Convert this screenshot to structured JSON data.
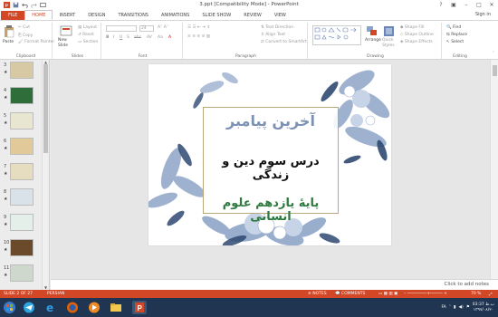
{
  "window": {
    "title": "3.ppt [Compatibility Mode] - PowerPoint"
  },
  "tabs": [
    {
      "label": "FILE"
    },
    {
      "label": "HOME"
    },
    {
      "label": "INSERT"
    },
    {
      "label": "DESIGN"
    },
    {
      "label": "TRANSITIONS"
    },
    {
      "label": "ANIMATIONS"
    },
    {
      "label": "SLIDE SHOW"
    },
    {
      "label": "REVIEW"
    },
    {
      "label": "VIEW"
    }
  ],
  "signin": "Sign in",
  "ribbon": {
    "clipboard": {
      "label": "Clipboard",
      "paste": "Paste",
      "cut": "Cut",
      "copy": "Copy",
      "format_painter": "Format Painter"
    },
    "slides": {
      "label": "Slides",
      "new_slide": "New Slide",
      "layout": "Layout",
      "reset": "Reset",
      "section": "Section"
    },
    "font": {
      "label": "Font",
      "size": "24"
    },
    "paragraph": {
      "label": "Paragraph",
      "text_direction": "Text Direction",
      "align_text": "Align Text",
      "smartart": "Convert to SmartArt"
    },
    "drawing": {
      "label": "Drawing",
      "arrange": "Arrange",
      "quick_styles": "Quick Styles",
      "fill": "Shape Fill",
      "outline": "Shape Outline",
      "effects": "Shape Effects"
    },
    "editing": {
      "label": "Editing",
      "find": "Find",
      "replace": "Replace",
      "select": "Select"
    }
  },
  "thumbnails": [
    {
      "num": "3",
      "star": "★",
      "color": "#d8c9a5"
    },
    {
      "num": "4",
      "star": "★",
      "color": "#2f6d3a"
    },
    {
      "num": "5",
      "star": "★",
      "color": "#e8e6d0"
    },
    {
      "num": "6",
      "star": "★",
      "color": "#e1c99a"
    },
    {
      "num": "7",
      "star": "★",
      "color": "#e6dcc0"
    },
    {
      "num": "8",
      "star": "★",
      "color": "#d9e2e8"
    },
    {
      "num": "9",
      "star": "★",
      "color": "#e4efe9"
    },
    {
      "num": "10",
      "star": "★",
      "color": "#6b4a2b"
    },
    {
      "num": "11",
      "star": "★",
      "color": "#cfd8cc"
    }
  ],
  "slide": {
    "title": "آخرین پیامبر",
    "subtitle": "درس سوم دین و زندگی",
    "footer": "پایهٔ یازدهم علوم انسانی"
  },
  "notes_placeholder": "Click to add notes",
  "status": {
    "slide_counter": "SLIDE 2 OF 27",
    "language": "PERSIAN",
    "notes": "NOTES",
    "comments": "COMMENTS",
    "zoom": "70 %"
  },
  "tray": {
    "time": "03:37 ب.ظ",
    "date": "۱۳۹۷/۰۸/۲۰",
    "lang": "FA"
  }
}
